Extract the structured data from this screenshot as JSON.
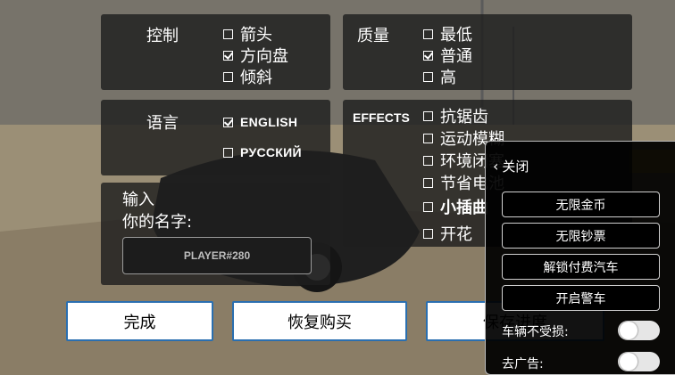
{
  "colors": {
    "panel": "#1e1e1e",
    "button_border": "#2a6fb0",
    "cheat_bg": "#000000"
  },
  "control": {
    "label": "控制",
    "options": [
      {
        "label": "箭头",
        "checked": false
      },
      {
        "label": "方向盘",
        "checked": true
      },
      {
        "label": "倾斜",
        "checked": false
      }
    ]
  },
  "quality": {
    "label": "质量",
    "options": [
      {
        "label": "最低",
        "checked": false
      },
      {
        "label": "普通",
        "checked": true
      },
      {
        "label": "高",
        "checked": false
      }
    ]
  },
  "language": {
    "label": "语言",
    "options": [
      {
        "label": "ENGLISH",
        "checked": true
      },
      {
        "label": "РУССКИЙ",
        "checked": false
      }
    ]
  },
  "effects": {
    "label": "EFFECTS",
    "options": [
      {
        "label": "抗锯齿",
        "checked": false
      },
      {
        "label": "运动模糊",
        "checked": false
      },
      {
        "label": "环境闭塞",
        "checked": false
      },
      {
        "label": "节省电池",
        "checked": false
      },
      {
        "label": "小插曲",
        "checked": false
      },
      {
        "label": "开花",
        "checked": false
      }
    ]
  },
  "name": {
    "label_line1": "输入",
    "label_line2": "你的名字:",
    "value": "PLAYER#280"
  },
  "buttons": {
    "done": "完成",
    "restore": "恢复购买",
    "save": "保存进度"
  },
  "cheat_menu": {
    "close_label": "关闭",
    "items": [
      "无限金币",
      "无限钞票",
      "解锁付费汽车",
      "开启警车"
    ],
    "toggles": [
      {
        "label": "车辆不受损:",
        "on": false
      },
      {
        "label": "去广告:",
        "on": false
      }
    ]
  }
}
